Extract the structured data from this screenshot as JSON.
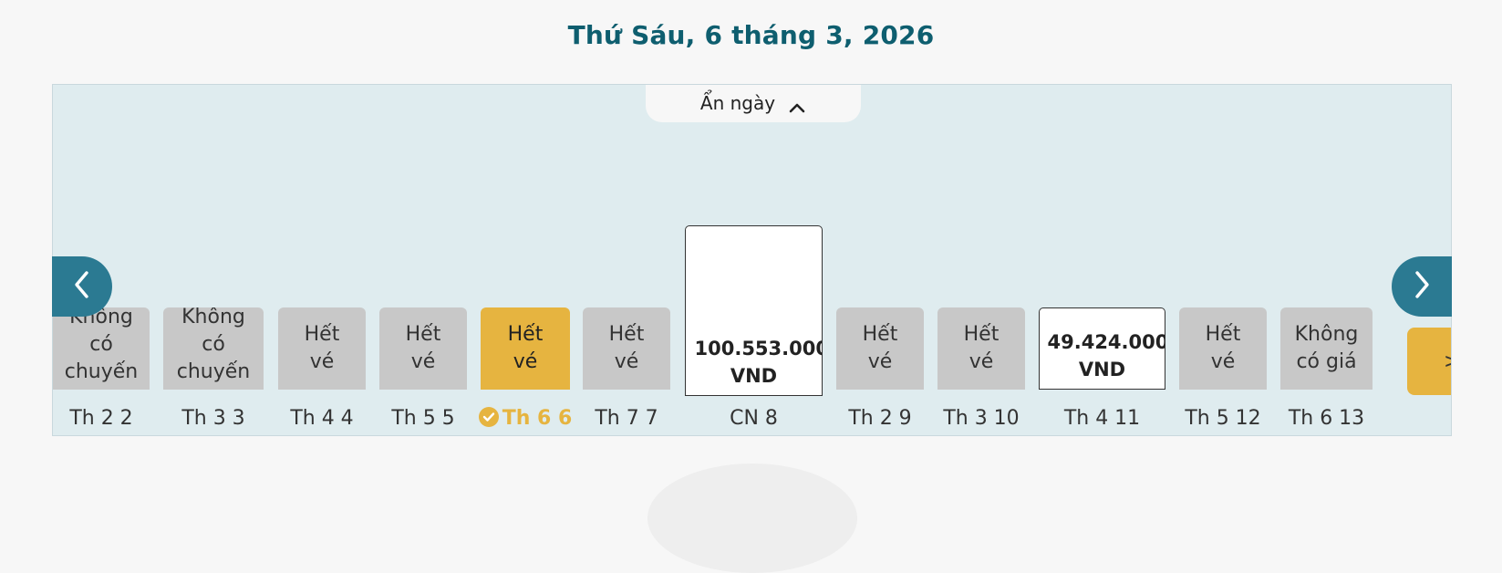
{
  "header": {
    "date_title": "Thứ Sáu, 6 tháng 3, 2026"
  },
  "toggle": {
    "label": "Ẩn ngày",
    "icon": "chevron-up-icon"
  },
  "nav": {
    "prev_icon": "chevron-left-icon",
    "next_icon": "chevron-right-icon",
    "accent": "#2b7a92"
  },
  "colors": {
    "title": "#0e5e6f",
    "selected": "#e6b440",
    "unavailable": "#c8c8c8",
    "panel": "#dfecef"
  },
  "days": [
    {
      "label": "Th 2 2",
      "status": "Không có chuyến",
      "type": "unavailable"
    },
    {
      "label": "Th 3 3",
      "status": "Không có chuyến",
      "type": "unavailable"
    },
    {
      "label": "Th 4 4",
      "status": "Hết vé",
      "type": "unavailable"
    },
    {
      "label": "Th 5 5",
      "status": "Hết vé",
      "type": "unavailable"
    },
    {
      "label": "Th 6 6",
      "status": "Hết vé",
      "type": "selected"
    },
    {
      "label": "Th 7 7",
      "status": "Hết vé",
      "type": "unavailable"
    },
    {
      "label": "CN 8",
      "status": "100.553.000 VND",
      "type": "price"
    },
    {
      "label": "Th 2 9",
      "status": "Hết vé",
      "type": "unavailable"
    },
    {
      "label": "Th 3 10",
      "status": "Hết vé",
      "type": "unavailable"
    },
    {
      "label": "Th 4 11",
      "status": "49.424.000 VND",
      "type": "price"
    },
    {
      "label": "Th 5 12",
      "status": "Hết vé",
      "type": "unavailable"
    },
    {
      "label": "Th 6 13",
      "status": "Không có giá",
      "type": "unavailable"
    }
  ],
  "more": {
    "label": ">"
  }
}
